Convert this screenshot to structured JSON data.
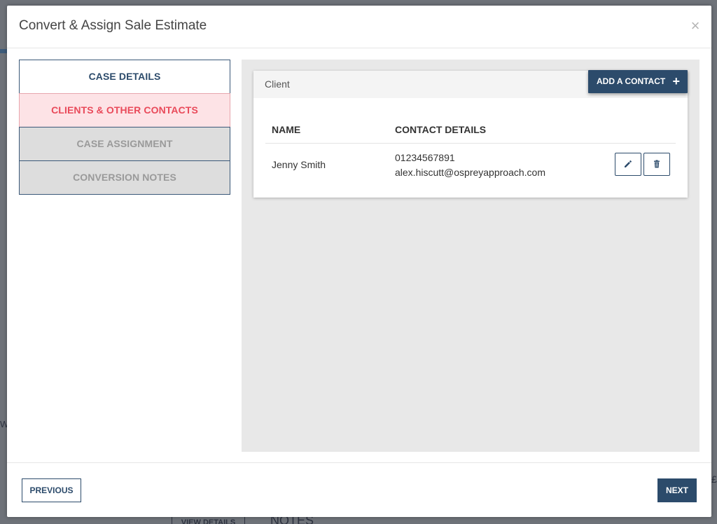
{
  "background": {
    "tab_view_details": "VIEW DETAILS",
    "tab_notes": "NOTES",
    "edge_char": "£",
    "edge_w": "W"
  },
  "modal": {
    "title": "Convert & Assign Sale Estimate",
    "close_glyph": "×"
  },
  "steps": [
    {
      "label": "CASE DETAILS",
      "state": "done"
    },
    {
      "label": "CLIENTS & OTHER CONTACTS",
      "state": "current"
    },
    {
      "label": "CASE ASSIGNMENT",
      "state": "disabled"
    },
    {
      "label": "CONVERSION NOTES",
      "state": "disabled"
    }
  ],
  "card": {
    "title": "Client",
    "add_contact_label": "ADD A CONTACT",
    "add_contact_icon": "plus-icon",
    "columns": [
      "NAME",
      "CONTACT DETAILS"
    ],
    "rows": [
      {
        "name": "Jenny Smith",
        "phone": "01234567891",
        "email": "alex.hiscutt@ospreyapproach.com"
      }
    ]
  },
  "footer": {
    "previous_label": "PREVIOUS",
    "next_label": "NEXT"
  },
  "colors": {
    "primary": "#2c4b6b",
    "current_step_text": "#e94a5a",
    "current_step_bg": "#fde3e6",
    "disabled_step_bg": "#dddddd",
    "panel_bg": "#e8e8e8"
  }
}
